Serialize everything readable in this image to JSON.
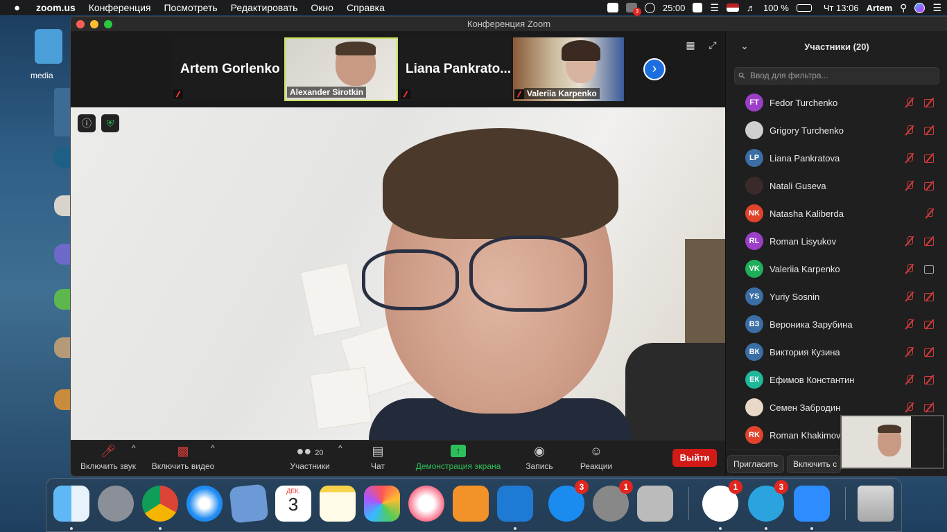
{
  "menubar": {
    "apple": "",
    "app_name": "zoom.us",
    "items": [
      "Конференция",
      "Посмотреть",
      "Редактировать",
      "Окно",
      "Справка"
    ],
    "timer": "25:00",
    "battery": "100 %",
    "clock": "Чт 13:06",
    "user": "Artem",
    "badge": "3"
  },
  "desktop": {
    "file_label": "media"
  },
  "window": {
    "title": "Конференция Zoom"
  },
  "thumbnails": [
    {
      "name": "Artem Gorlenko",
      "kind": "name-only"
    },
    {
      "name": "Alexander Sirotkin",
      "kind": "video"
    },
    {
      "name": "Liana Pankrato...",
      "kind": "name-only"
    },
    {
      "name": "Valeriia Karpenko",
      "kind": "video"
    }
  ],
  "toolbar": {
    "audio": "Включить звук",
    "video": "Включить видео",
    "participants": "Участники",
    "participants_count": "20",
    "chat": "Чат",
    "share": "Демонстрация экрана",
    "record": "Запись",
    "reactions": "Реакции",
    "leave": "Выйти"
  },
  "panel": {
    "title": "Участники (20)",
    "filter_placeholder": "Ввод для фильтра...",
    "invite": "Пригласить",
    "unmute_all": "Включить с",
    "participants": [
      {
        "initials": "FT",
        "name": "Fedor Turchenko",
        "color": "#9b3fc7",
        "mic": "off",
        "video": "off"
      },
      {
        "initials": "",
        "name": "Grigory Turchenko",
        "color": "#cfcfcf",
        "mic": "off",
        "video": "off"
      },
      {
        "initials": "LP",
        "name": "Liana Pankratova",
        "color": "#3a6ea5",
        "mic": "off",
        "video": "off"
      },
      {
        "initials": "",
        "name": "Natali Guseva",
        "color": "#3a2a2a",
        "mic": "off",
        "video": "off"
      },
      {
        "initials": "NK",
        "name": "Natasha Kaliberda",
        "color": "#e0432b",
        "mic": "none",
        "video": "off"
      },
      {
        "initials": "RL",
        "name": "Roman Lisyukov",
        "color": "#9b3fc7",
        "mic": "off",
        "video": "off"
      },
      {
        "initials": "VK",
        "name": "Valeriia Karpenko",
        "color": "#1fae5a",
        "mic": "off",
        "video": "on"
      },
      {
        "initials": "YS",
        "name": "Yuriy Sosnin",
        "color": "#3a6ea5",
        "mic": "off",
        "video": "off"
      },
      {
        "initials": "ВЗ",
        "name": "Вероника Зарубина",
        "color": "#3a6ea5",
        "mic": "off",
        "video": "off"
      },
      {
        "initials": "ВК",
        "name": "Виктория Кузина",
        "color": "#3a6ea5",
        "mic": "off",
        "video": "off"
      },
      {
        "initials": "ЕК",
        "name": "Ефимов Константин",
        "color": "#1fb89a",
        "mic": "off",
        "video": "off"
      },
      {
        "initials": "",
        "name": "Семен Забродин",
        "color": "#e8d8c8",
        "mic": "off",
        "video": "off"
      },
      {
        "initials": "RK",
        "name": "Roman Khakimov",
        "color": "#e0432b",
        "mic": "off",
        "video": "off"
      }
    ]
  },
  "dock": {
    "calendar_month": "ДЕК.",
    "calendar_day": "3",
    "badges": {
      "appstore": "3",
      "settings": "1",
      "slack": "1",
      "telegram": "3"
    }
  }
}
